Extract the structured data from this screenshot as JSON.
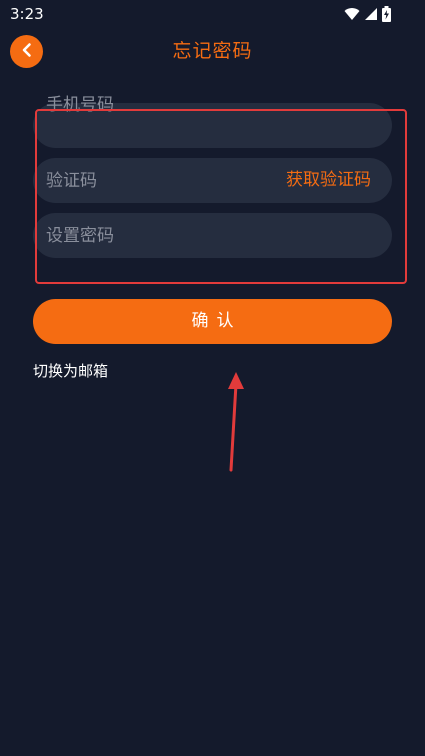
{
  "status_bar": {
    "time": "3:23",
    "icons": [
      "wifi-icon",
      "signal-icon",
      "battery-icon"
    ]
  },
  "header": {
    "back_icon": "chevron-left-icon",
    "title": "忘记密码"
  },
  "form": {
    "phone_placeholder": "手机号码",
    "phone_value": "",
    "code_placeholder": "验证码",
    "code_value": "",
    "get_code_label": "获取验证码",
    "password_placeholder": "设置密码",
    "password_value": ""
  },
  "actions": {
    "confirm_label": "确认",
    "switch_email_label": "切换为邮箱"
  },
  "colors": {
    "background": "#141a2c",
    "accent": "#f56c12",
    "field_background": "#252d3f",
    "placeholder": "#8a8f9c",
    "annotation": "#e23b3b"
  }
}
